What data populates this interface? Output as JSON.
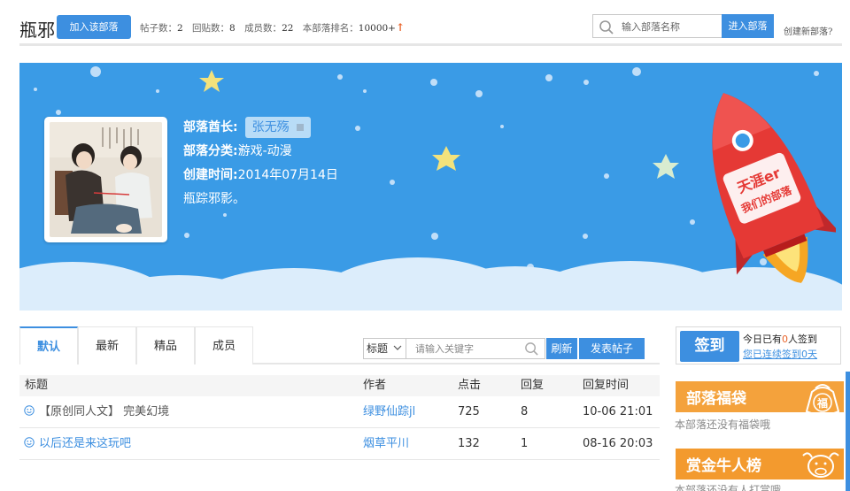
{
  "header": {
    "tribe_name": "瓶邪",
    "join_label": "加入该部落",
    "stats": [
      {
        "label": "帖子数：",
        "value": "2"
      },
      {
        "label": "回贴数：",
        "value": "8"
      },
      {
        "label": "成员数：",
        "value": "22"
      },
      {
        "label": "本部落排名：",
        "value": "10000+"
      }
    ],
    "rank_trend_glyph": "↑",
    "search_placeholder": "输入部落名称",
    "enter_label": "进入部落",
    "create_label": "创建新部落?"
  },
  "banner": {
    "leader_label": "部落酋长:",
    "leader_name": "张无殇",
    "category_label": "部落分类:",
    "category_value": "游戏-动漫",
    "created_label": "创建时间:",
    "created_value": "2014年07月14日",
    "description": "瓶踪邪影。",
    "rocket_line1": "天涯er",
    "rocket_line2": "我们的部落",
    "colors": {
      "sky": "#3a9be6",
      "cloud": "#dcedfb",
      "rocket": "#e53935",
      "star": "#f7e27a"
    }
  },
  "tabs": [
    "默认",
    "最新",
    "精品",
    "成员"
  ],
  "filter": {
    "select_value": "标题",
    "keyword_placeholder": "请输入关键字",
    "refresh_label": "刷新",
    "post_label": "发表帖子"
  },
  "table": {
    "headers": [
      "标题",
      "作者",
      "点击",
      "回复",
      "回复时间"
    ],
    "rows": [
      {
        "title": "【原创同人文】 完美幻境",
        "author": "绿野仙踪jl",
        "clicks": "725",
        "replies": "8",
        "time": "10-06 21:01"
      },
      {
        "title": "以后还是来这玩吧",
        "author": "烟草平川",
        "clicks": "132",
        "replies": "1",
        "time": "08-16 20:03"
      }
    ]
  },
  "sidebar": {
    "sign_label": "签到",
    "today_prefix": "今日已有",
    "today_count": "0",
    "today_suffix": "人签到",
    "streak_text": "您已连续签到0天",
    "bag_title": "部落福袋",
    "bag_badge": "福",
    "bag_note": "本部落还没有福袋哦",
    "bounty_title": "赏金牛人榜",
    "bounty_note": "本部落还没有人打赏哦",
    "colors": {
      "bag": "#f4a23c",
      "bounty": "#f39a2e"
    }
  },
  "icons": {
    "search": "search-icon",
    "face": "smiley-face-icon",
    "chevron": "chevron-down-icon"
  }
}
